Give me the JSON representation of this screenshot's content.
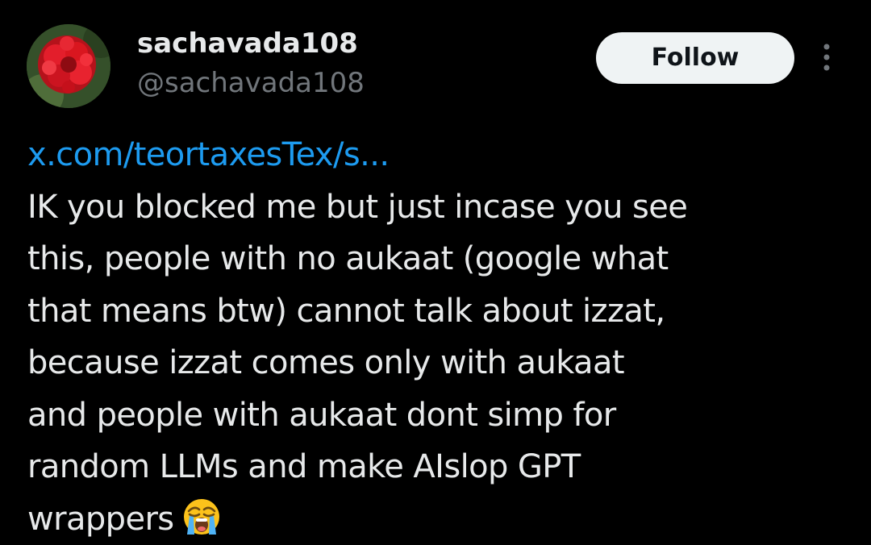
{
  "author": {
    "display_name": "sachavada108",
    "handle": "@sachavada108",
    "avatar_icon": "red-flower-avatar"
  },
  "actions": {
    "follow_label": "Follow",
    "more_icon": "more-vertical-icon"
  },
  "tweet": {
    "link_text": "x.com/teortaxesTex/s...",
    "lines": [
      "IK you blocked me but just incase you see",
      "this, people with no aukaat (google what",
      "that means btw) cannot talk about izzat,",
      "because izzat comes only with aukaat",
      "and people with aukaat dont simp for",
      "random LLMs and make AIslop GPT",
      "wrappers"
    ],
    "emoji": "loudly-crying-face-emoji"
  },
  "colors": {
    "background": "#000000",
    "text": "#e7e9ea",
    "secondary_text": "#71767b",
    "link": "#1d9bf0",
    "follow_bg": "#eff3f4",
    "follow_text": "#0f1419"
  }
}
